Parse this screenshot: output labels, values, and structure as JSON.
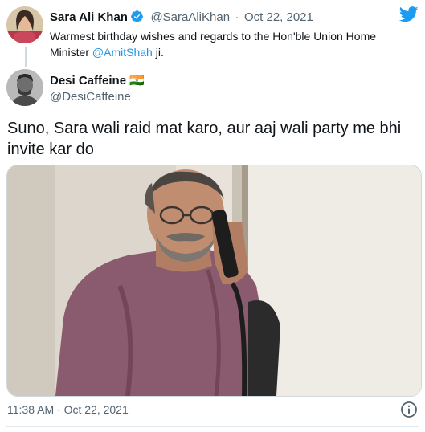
{
  "quoted_tweet": {
    "author_name": "Sara Ali Khan",
    "handle": "@SaraAliKhan",
    "separator": "·",
    "date": "Oct 22, 2021",
    "text_before_mention": "Warmest birthday wishes and regards to the Hon'ble Union Home Minister ",
    "mention": "@AmitShah",
    "text_after_mention": " ji."
  },
  "main_tweet": {
    "author_name": "Desi Caffeine 🇮🇳",
    "handle": "@DesiCaffeine",
    "text": "Suno, Sara wali raid mat karo, aur aaj wali party me bhi invite kar do",
    "time": "11:38 AM",
    "separator": "·",
    "date": "Oct 22, 2021"
  },
  "colors": {
    "brand_blue": "#1d9bf0",
    "link_blue": "#1b95e0",
    "muted_text": "#536471"
  },
  "icons": [
    "twitter-bird-icon",
    "verified-badge-icon",
    "info-icon"
  ]
}
